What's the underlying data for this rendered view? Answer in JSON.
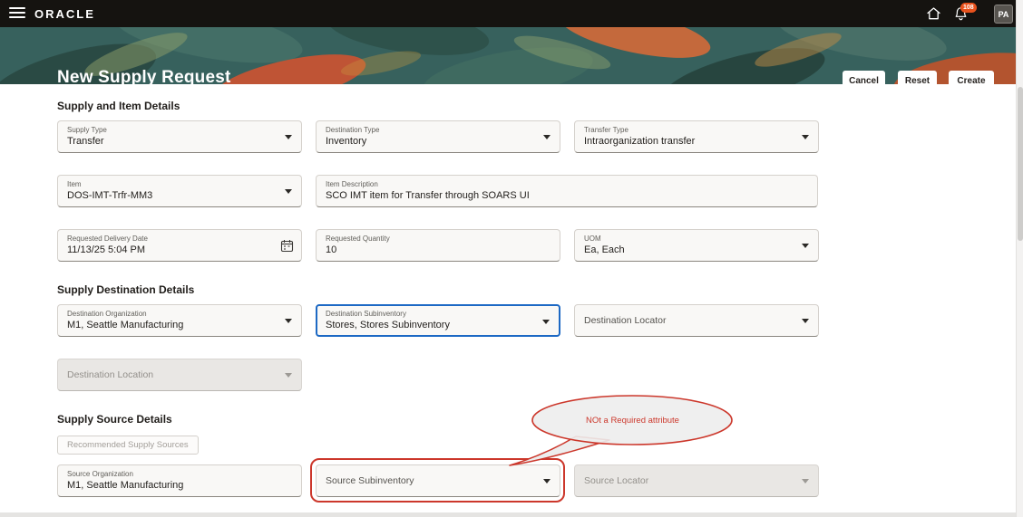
{
  "topbar": {
    "brand": "ORACLE",
    "notification_count": "108",
    "avatar_initials": "PA"
  },
  "header": {
    "title": "New Supply Request",
    "cancel": "Cancel",
    "reset": "Reset",
    "create": "Create"
  },
  "supply_item": {
    "heading": "Supply and Item Details",
    "supply_type": {
      "label": "Supply Type",
      "value": "Transfer"
    },
    "destination_type": {
      "label": "Destination Type",
      "value": "Inventory"
    },
    "transfer_type": {
      "label": "Transfer Type",
      "value": "Intraorganization transfer"
    },
    "item": {
      "label": "Item",
      "value": "DOS-IMT-Trfr-MM3"
    },
    "item_description": {
      "label": "Item Description",
      "value": "SCO IMT item for Transfer through SOARS UI"
    },
    "requested_delivery_date": {
      "label": "Requested Delivery Date",
      "value": "11/13/25 5:04 PM"
    },
    "requested_quantity": {
      "label": "Requested Quantity",
      "value": "10"
    },
    "uom": {
      "label": "UOM",
      "value": "Ea,  Each"
    }
  },
  "destination": {
    "heading": "Supply Destination Details",
    "organization": {
      "label": "Destination Organization",
      "value": "M1,  Seattle Manufacturing"
    },
    "subinventory": {
      "label": "Destination Subinventory",
      "value": "Stores,  Stores Subinventory"
    },
    "locator": {
      "label": "Destination Locator",
      "value": ""
    },
    "location": {
      "label": "Destination Location",
      "value": ""
    }
  },
  "source": {
    "heading": "Supply Source Details",
    "recommended_button": "Recommended Supply Sources",
    "organization": {
      "label": "Source Organization",
      "value": "M1, Seattle Manufacturing"
    },
    "subinventory": {
      "label": "Source Subinventory",
      "value": ""
    },
    "locator": {
      "label": "Source Locator",
      "value": ""
    }
  },
  "annotation": {
    "text": "NOt a Required attribute"
  },
  "colors": {
    "annotation_red": "#cc372b",
    "focus_blue": "#1d69c4",
    "badge_orange": "#e8521d",
    "banner_teal": "#37615d",
    "topbar_black": "#151310"
  }
}
